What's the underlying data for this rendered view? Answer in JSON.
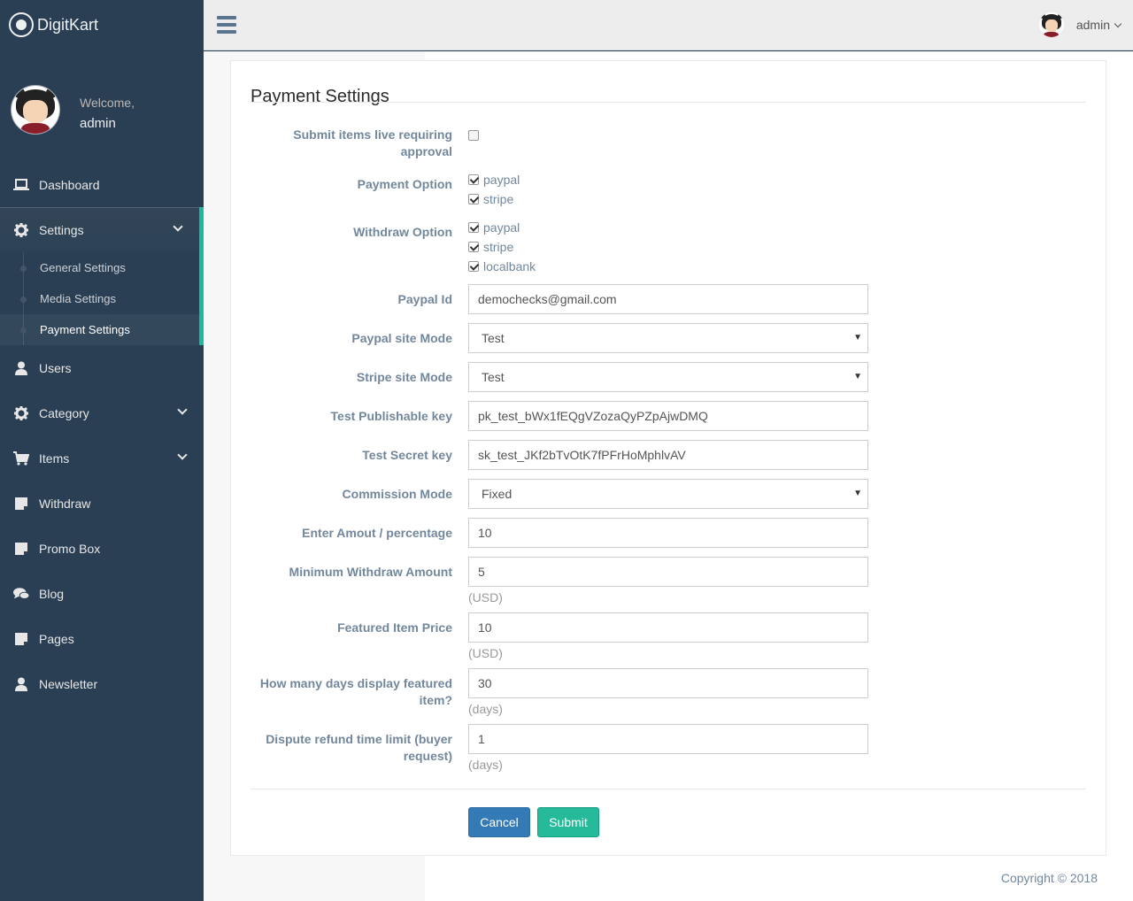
{
  "brand": {
    "name": "DigitKart"
  },
  "profile": {
    "welcome": "Welcome,",
    "name": "admin"
  },
  "sidebar": {
    "items": [
      {
        "label": "Dashboard",
        "icon": "laptop-icon"
      },
      {
        "label": "Settings",
        "icon": "gear-icon",
        "expanded": true
      },
      {
        "label": "Users",
        "icon": "user-icon"
      },
      {
        "label": "Category",
        "icon": "gear-icon"
      },
      {
        "label": "Items",
        "icon": "cart-icon"
      },
      {
        "label": "Withdraw",
        "icon": "note-icon"
      },
      {
        "label": "Promo Box",
        "icon": "note-icon"
      },
      {
        "label": "Blog",
        "icon": "comments-icon"
      },
      {
        "label": "Pages",
        "icon": "note-icon"
      },
      {
        "label": "Newsletter",
        "icon": "user-icon"
      }
    ],
    "settings_sub": [
      {
        "label": "General Settings"
      },
      {
        "label": "Media Settings"
      },
      {
        "label": "Payment Settings",
        "current": true
      }
    ]
  },
  "topbar": {
    "user": "admin"
  },
  "page": {
    "title": "Payment Settings"
  },
  "form": {
    "approval": {
      "label": "Submit items live requiring approval",
      "checked": false
    },
    "payment_option": {
      "label": "Payment Option",
      "options": [
        "paypal",
        "stripe"
      ]
    },
    "withdraw_option": {
      "label": "Withdraw Option",
      "options": [
        "paypal",
        "stripe",
        "localbank"
      ]
    },
    "paypal_id": {
      "label": "Paypal Id",
      "value": "demochecks@gmail.com"
    },
    "paypal_mode": {
      "label": "Paypal site Mode",
      "value": "Test"
    },
    "stripe_mode": {
      "label": "Stripe site Mode",
      "value": "Test"
    },
    "pub_key": {
      "label": "Test Publishable key",
      "value": "pk_test_bWx1fEQgVZozaQyPZpAjwDMQ"
    },
    "secret_key": {
      "label": "Test Secret key",
      "value": "sk_test_JKf2bTvOtK7fPFrHoMphlvAV"
    },
    "commission_mode": {
      "label": "Commission Mode",
      "value": "Fixed"
    },
    "amount": {
      "label": "Enter Amout / percentage",
      "value": "10"
    },
    "min_withdraw": {
      "label": "Minimum Withdraw Amount",
      "value": "5",
      "help": "(USD)"
    },
    "featured_price": {
      "label": "Featured Item Price",
      "value": "10",
      "help": "(USD)"
    },
    "featured_days": {
      "label": "How many days display featured item?",
      "value": "30",
      "help": "(days)"
    },
    "dispute_limit": {
      "label": "Dispute refund time limit (buyer request)",
      "value": "1",
      "help": "(days)"
    },
    "cancel_label": "Cancel",
    "submit_label": "Submit"
  },
  "footer": {
    "copyright": "Copyright © 2018"
  },
  "colors": {
    "sidebar": "#2a3f54",
    "accent": "#1abb9c",
    "primary": "#337ab7",
    "success": "#26b99a"
  }
}
